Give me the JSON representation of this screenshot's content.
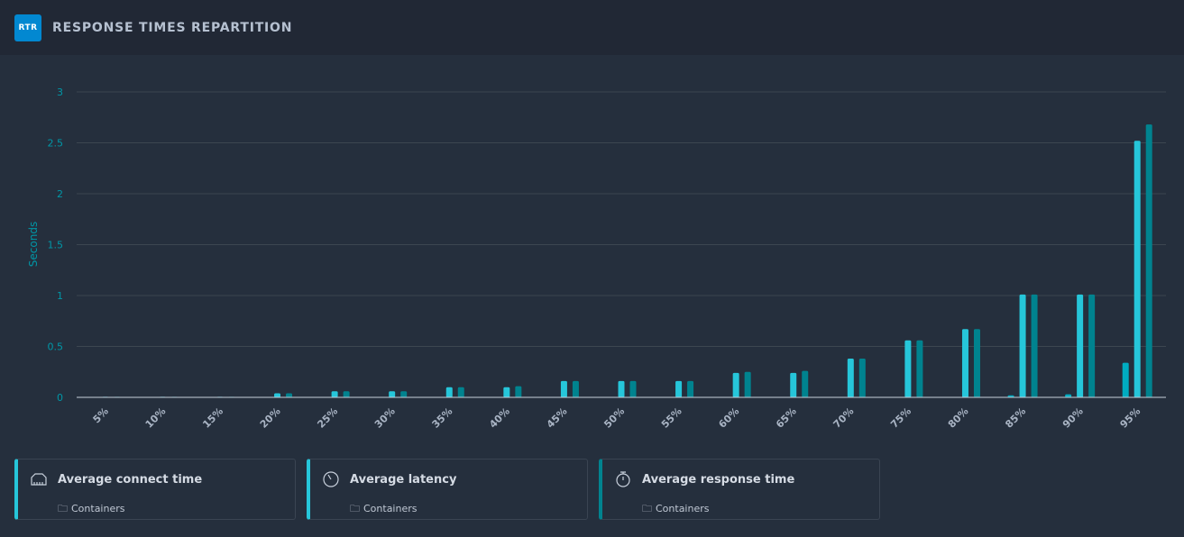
{
  "header": {
    "logo": "RTR",
    "title": "RESPONSE TIMES REPARTITION"
  },
  "chart_data": {
    "type": "bar",
    "ylabel": "Seconds",
    "ylim": [
      0,
      3
    ],
    "yticks": [
      "0",
      "0.5",
      "1",
      "1.5",
      "2",
      "2.5",
      "3"
    ],
    "grid": true,
    "categories": [
      "5%",
      "10%",
      "15%",
      "20%",
      "25%",
      "30%",
      "35%",
      "40%",
      "45%",
      "50%",
      "55%",
      "60%",
      "65%",
      "70%",
      "75%",
      "80%",
      "85%",
      "90%",
      "95%"
    ],
    "series": [
      {
        "name": "Average connect time",
        "color": "#00acc1",
        "values": [
          0,
          0,
          0,
          0,
          0,
          0,
          0,
          0,
          0,
          0,
          0,
          0,
          0,
          0,
          0,
          0,
          0.02,
          0.03,
          0.34
        ]
      },
      {
        "name": "Average latency",
        "color": "#26c6da",
        "values": [
          0.005,
          0.005,
          0.005,
          0.04,
          0.06,
          0.06,
          0.1,
          0.1,
          0.16,
          0.16,
          0.16,
          0.24,
          0.24,
          0.38,
          0.56,
          0.67,
          1.01,
          1.01,
          2.52
        ]
      },
      {
        "name": "Average response time",
        "color": "#00838f",
        "values": [
          0.005,
          0.005,
          0.005,
          0.04,
          0.06,
          0.06,
          0.1,
          0.11,
          0.16,
          0.16,
          0.16,
          0.25,
          0.26,
          0.38,
          0.56,
          0.67,
          1.01,
          1.01,
          2.68
        ]
      }
    ]
  },
  "legend": [
    {
      "label": "Average connect time",
      "sub": "Containers",
      "icon": "ethernet-port-icon",
      "accent": "#26c6da"
    },
    {
      "label": "Average latency",
      "sub": "Containers",
      "icon": "timer-dial-icon",
      "accent": "#26c6da"
    },
    {
      "label": "Average response time",
      "sub": "Containers",
      "icon": "stopwatch-icon",
      "accent": "#00838f"
    }
  ]
}
